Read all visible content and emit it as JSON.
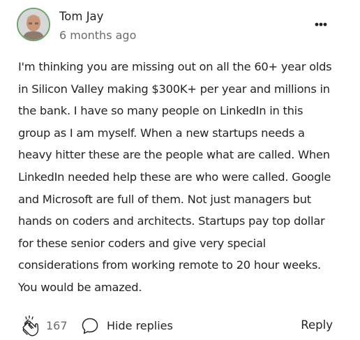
{
  "comment": {
    "author": "Tom Jay",
    "timestamp": "6 months ago",
    "lines": [
      "I'm thinking you are missing out on all the 60+ year olds",
      "in Silicon Valley making $300K+ per year and millions in",
      "the bank. I have so many people on LinkedIn in this",
      "group as I am myself. When a new startups needs a",
      "heavy hitter these are the people what are called. When",
      "LinkedIn needed help these are who were called. Google",
      "and Microsoft are full of them. Not just managers but",
      "hands on coders and architects. Startups pay top dollar",
      "for these senior coders and give very special",
      "considerations from working remote to 20 hour weeks.",
      "You would be amazed."
    ]
  },
  "actions": {
    "clap_count": "167",
    "hide_replies": "Hide replies",
    "reply": "Reply"
  },
  "icons": {
    "more": "more-horizontal-icon",
    "clap": "clap-icon",
    "replies": "speech-bubble-icon"
  },
  "colors": {
    "text": "#242424",
    "muted": "#6b6b6b",
    "avatar_ring": "#6fa36a"
  }
}
